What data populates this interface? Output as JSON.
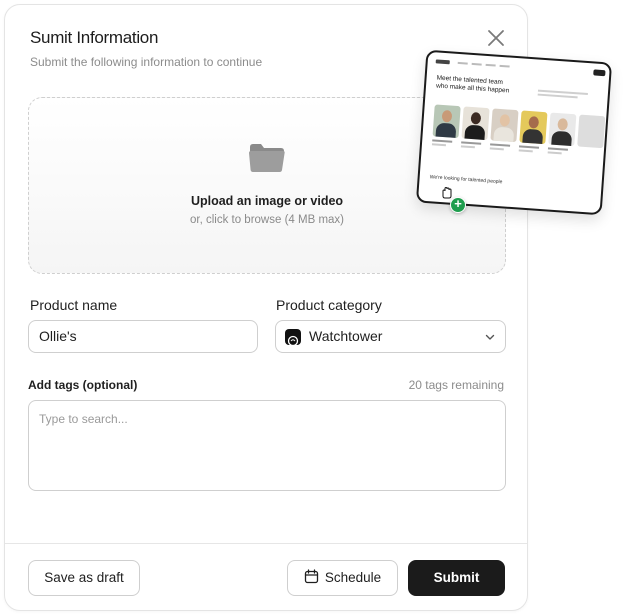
{
  "modal": {
    "title": "Sumit Information",
    "subtitle": "Submit the following information to continue"
  },
  "upload": {
    "primary_text": "Upload an image or video",
    "secondary_text": "or, click to browse (4 MB max)",
    "preview": {
      "heading": "Meet the talented team who make all this happen",
      "hiring_text": "We're looking for talented people"
    }
  },
  "product_name": {
    "label": "Product name",
    "value": "Ollie's"
  },
  "product_category": {
    "label": "Product category",
    "selected": "Watchtower"
  },
  "tags": {
    "label": "Add tags (optional)",
    "remaining": "20 tags remaining",
    "placeholder": "Type to search..."
  },
  "footer": {
    "draft_label": "Save as draft",
    "schedule_label": "Schedule",
    "submit_label": "Submit"
  },
  "icons": {
    "close": "close-icon",
    "folder": "folder-icon",
    "chevron": "chevron-down-icon",
    "calendar": "calendar-icon",
    "grab_cursor": "grab-hand-icon",
    "add": "plus-circle-icon"
  },
  "colors": {
    "primary_button": "#1b1b1b",
    "add_badge": "#1f9d4e",
    "border": "#cfcfcf"
  }
}
